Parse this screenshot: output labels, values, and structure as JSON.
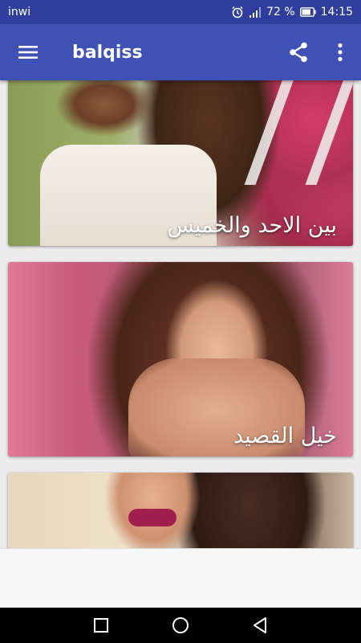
{
  "status_bar": {
    "carrier": "inwi",
    "battery": "72 %",
    "time": "14:15",
    "icons": [
      "alarm-icon",
      "signal-icon",
      "battery-icon"
    ]
  },
  "app_bar": {
    "title": "balqiss",
    "icons": [
      "hamburger-menu-icon",
      "share-icon",
      "more-vert-icon"
    ]
  },
  "cards": [
    {
      "caption": "بين الاحد والخميس"
    },
    {
      "caption": "خيل القصيد"
    },
    {
      "caption": ""
    }
  ],
  "nav_bar": {
    "icons": [
      "recents-square-icon",
      "home-circle-icon",
      "back-triangle-icon"
    ]
  },
  "colors": {
    "status_bar": "#2f3e9e",
    "app_bar": "#3f51b5",
    "background": "#ececec"
  }
}
